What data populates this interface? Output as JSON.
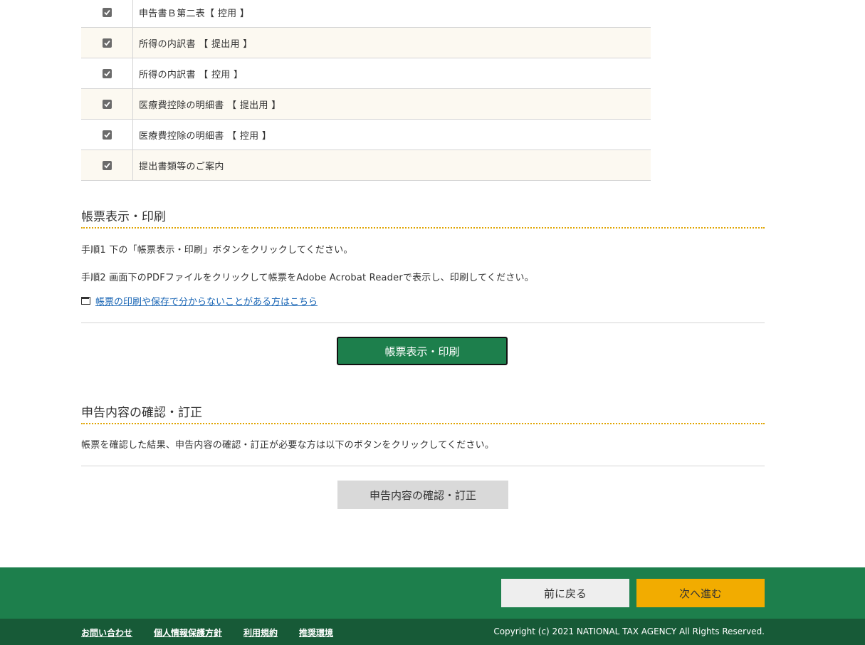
{
  "documents": [
    {
      "label": "申告書Ｂ第二表【 控用 】",
      "checked": true
    },
    {
      "label": "所得の内訳書 【 提出用 】",
      "checked": true
    },
    {
      "label": "所得の内訳書 【 控用 】",
      "checked": true
    },
    {
      "label": "医療費控除の明細書 【 提出用 】",
      "checked": true
    },
    {
      "label": "医療費控除の明細書 【 控用 】",
      "checked": true
    },
    {
      "label": "提出書類等のご案内",
      "checked": true
    }
  ],
  "print_section": {
    "title": "帳票表示・印刷",
    "step1": "手順1 下の「帳票表示・印刷」ボタンをクリックしてください。",
    "step2": "手順2 画面下のPDFファイルをクリックして帳票をAdobe Acrobat Readerで表示し、印刷してください。",
    "help_link": "帳票の印刷や保存で分からないことがある方はこちら",
    "button": "帳票表示・印刷"
  },
  "correct_section": {
    "title": "申告内容の確認・訂正",
    "description": "帳票を確認した結果、申告内容の確認・訂正が必要な方は以下のボタンをクリックしてください。",
    "button": "申告内容の確認・訂正"
  },
  "nav": {
    "back": "前に戻る",
    "next": "次へ進む"
  },
  "footer": {
    "links": [
      "お問い合わせ",
      "個人情報保護方針",
      "利用規約",
      "推奨環境"
    ],
    "copyright": "Copyright (c) 2021 NATIONAL TAX AGENCY All Rights Reserved."
  },
  "colors": {
    "primary_green": "#1d7f4c",
    "footer_dark": "#175a37",
    "next_button": "#f2ac00",
    "accent_dotted": "#e0a400",
    "link": "#1a66b5"
  }
}
